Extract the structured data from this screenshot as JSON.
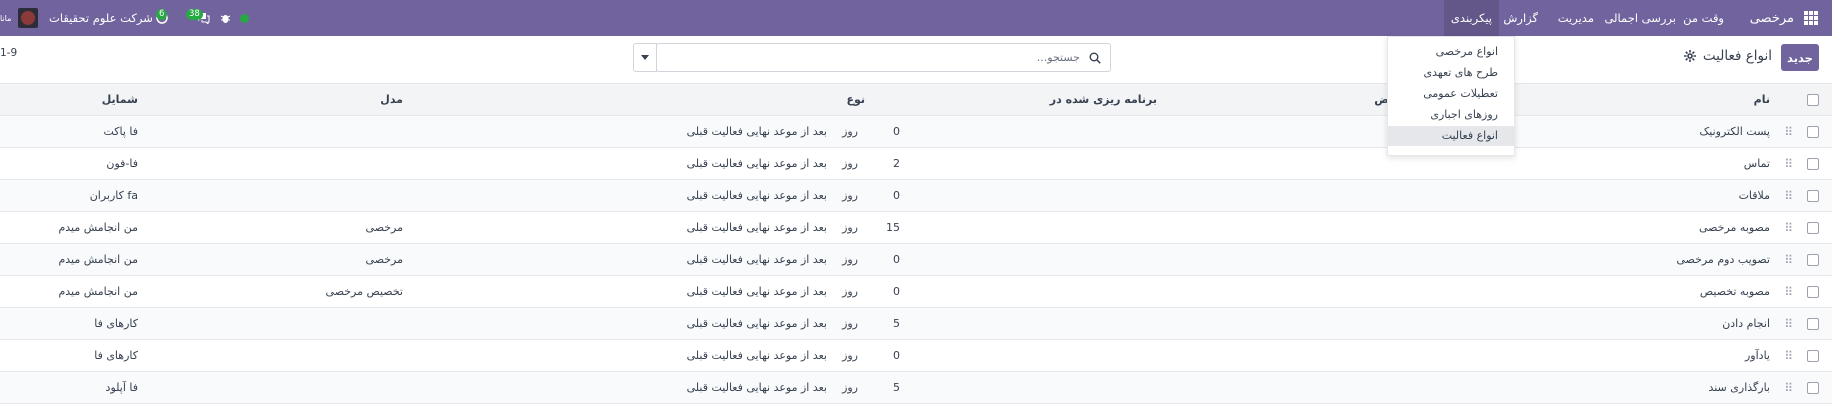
{
  "nav": {
    "app_name": "مرخصی",
    "menu": [
      "وقت من",
      "بررسی اجمالی",
      "مدیریت",
      "گزارش",
      "پیکربندی"
    ],
    "company": "شرکت علوم تحقیقات",
    "messages_count": "38",
    "activities_count": "6",
    "partial_label": "مانا"
  },
  "config_menu": {
    "items": [
      "انواع مرخصی",
      "طرح های تعهدی",
      "تعطیلات عمومی",
      "روزهای اجباری",
      "انواع فعالیت"
    ],
    "active_index": 4
  },
  "control": {
    "new_label": "جدید",
    "title": "انواع فعالیت",
    "search_placeholder": "جستجو...",
    "pager": "1-9"
  },
  "table": {
    "headers": {
      "name": "نام",
      "summary_partial": "ض",
      "planned": "برنامه ریزی شده در",
      "type": "نوع",
      "model": "مدل",
      "decoration": "شمایل"
    },
    "rows": [
      {
        "name": "پست الکترونیک",
        "days": "0",
        "unit": "روز",
        "type_text": "بعد از موعد نهایی فعالیت قبلی",
        "model": "",
        "decoration": "فا پاکت"
      },
      {
        "name": "تماس",
        "days": "2",
        "unit": "روز",
        "type_text": "بعد از موعد نهایی فعالیت قبلی",
        "model": "",
        "decoration": "فا-فون"
      },
      {
        "name": "ملاقات",
        "days": "0",
        "unit": "روز",
        "type_text": "بعد از موعد نهایی فعالیت قبلی",
        "model": "",
        "decoration": "کاربران fa"
      },
      {
        "name": "مصوبه مرخصی",
        "days": "15",
        "unit": "روز",
        "type_text": "بعد از موعد نهایی فعالیت قبلی",
        "model": "مرخصی",
        "decoration": "من انجامش میدم"
      },
      {
        "name": "تصویب دوم مرخصی",
        "days": "0",
        "unit": "روز",
        "type_text": "بعد از موعد نهایی فعالیت قبلی",
        "model": "مرخصی",
        "decoration": "من انجامش میدم"
      },
      {
        "name": "مصوبه تخصیص",
        "days": "0",
        "unit": "روز",
        "type_text": "بعد از موعد نهایی فعالیت قبلی",
        "model": "تخصیص مرخصی",
        "decoration": "من انجامش میدم"
      },
      {
        "name": "انجام دادن",
        "days": "5",
        "unit": "روز",
        "type_text": "بعد از موعد نهایی فعالیت قبلی",
        "model": "",
        "decoration": "کارهای فا"
      },
      {
        "name": "یادآور",
        "days": "0",
        "unit": "روز",
        "type_text": "بعد از موعد نهایی فعالیت قبلی",
        "model": "",
        "decoration": "کارهای فا"
      },
      {
        "name": "بارگذاری سند",
        "days": "5",
        "unit": "روز",
        "type_text": "بعد از موعد نهایی فعالیت قبلی",
        "model": "",
        "decoration": "فا آپلود"
      }
    ]
  },
  "colors": {
    "brand": "#71639e",
    "online": "#28a745",
    "badge": "#28a745"
  }
}
